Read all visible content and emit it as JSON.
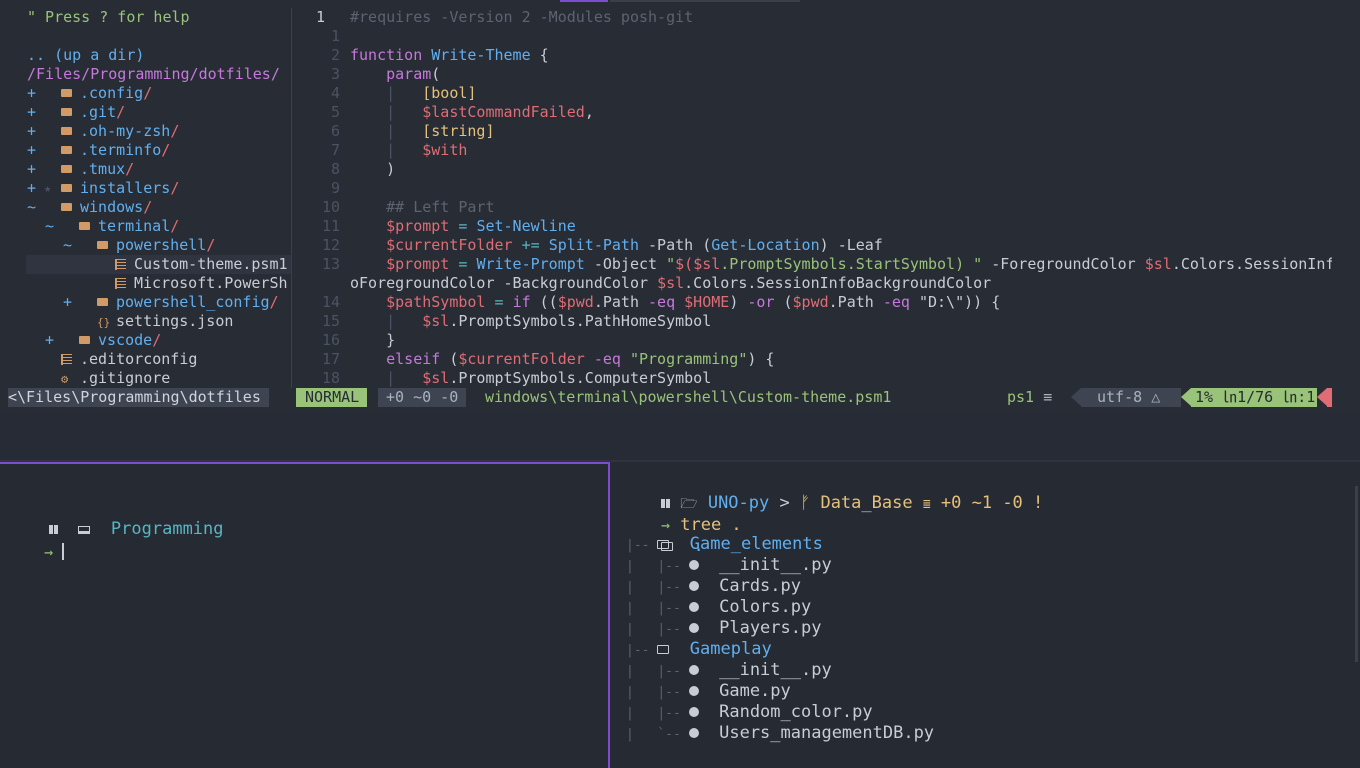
{
  "nerdtree": {
    "help": "\" Press ? for help",
    "up": ".. (up a dir)",
    "root": "/Files/Programming/dotfiles/",
    "items": [
      {
        "mark": "+",
        "name": ".config",
        "slash": "/",
        "type": "dir",
        "indent": 0
      },
      {
        "mark": "+",
        "name": ".git",
        "slash": "/",
        "type": "dir",
        "indent": 0
      },
      {
        "mark": "+",
        "name": ".oh-my-zsh",
        "slash": "/",
        "type": "dir",
        "indent": 0
      },
      {
        "mark": "+",
        "name": ".terminfo",
        "slash": "/",
        "type": "dir",
        "indent": 0
      },
      {
        "mark": "+",
        "name": ".tmux",
        "slash": "/",
        "type": "dir",
        "indent": 0
      },
      {
        "mark": "+",
        "name": "installers",
        "slash": "/",
        "type": "dir",
        "indent": 0
      },
      {
        "mark": "~",
        "name": "windows",
        "slash": "/",
        "type": "dir",
        "indent": 0
      },
      {
        "mark": "~",
        "name": "terminal",
        "slash": "/",
        "type": "dir",
        "indent": 1
      },
      {
        "mark": "~",
        "name": "powershell",
        "slash": "/",
        "type": "dir",
        "indent": 2
      },
      {
        "mark": "",
        "name": "Custom-theme.psm1",
        "slash": "",
        "type": "file",
        "indent": 3
      },
      {
        "mark": "",
        "name": "Microsoft.PowerSh",
        "slash": "",
        "type": "file",
        "indent": 3
      },
      {
        "mark": "+",
        "name": "powershell_config",
        "slash": "/",
        "type": "dir",
        "indent": 2
      },
      {
        "mark": "",
        "name": "settings.json",
        "slash": "",
        "type": "file",
        "indent": 2
      },
      {
        "mark": "+",
        "name": "vscode",
        "slash": "/",
        "type": "dir",
        "indent": 1
      },
      {
        "mark": "",
        "name": ".editorconfig",
        "slash": "",
        "type": "file",
        "indent": 0
      },
      {
        "mark": "",
        "name": ".gitignore",
        "slash": "",
        "type": "file",
        "indent": 0
      }
    ]
  },
  "editor": {
    "line_numbers": [
      "1",
      "1",
      "2",
      "3",
      "4",
      "5",
      "6",
      "7",
      "8",
      "9",
      "10",
      "11",
      "12",
      "13",
      "",
      "14",
      "15",
      "16",
      "17",
      "18"
    ],
    "lines": [
      "#requires -Version 2 -Modules posh-git",
      "",
      "function Write-Theme {",
      "    param(",
      "    |   [bool]",
      "    |   $lastCommandFailed,",
      "    |   [string]",
      "    |   $with",
      "    )",
      "",
      "    ## Left Part",
      "    $prompt = Set-Newline",
      "    $currentFolder += Split-Path -Path (Get-Location) -Leaf",
      "    $prompt = Write-Prompt -Object \"$($sl.PromptSymbols.StartSymbol) \" -ForegroundColor $sl.Colors.SessionInf",
      "oForegroundColor -BackgroundColor $sl.Colors.SessionInfoBackgroundColor",
      "    $pathSymbol = if (($pwd.Path -eq $HOME) -or ($pwd.Path -eq \"D:\\\")) {",
      "    |   $sl.PromptSymbols.PathHomeSymbol",
      "    }",
      "    elseif ($currentFolder -eq \"Programming\") {",
      "    |   $sl.PromptSymbols.ComputerSymbol"
    ]
  },
  "statusline": {
    "path": "<\\Files\\Programming\\dotfiles",
    "mode": "NORMAL",
    "git": "+0 ~0 -0",
    "file": "windows\\terminal\\powershell\\Custom-theme.psm1",
    "filetype": "ps1",
    "encoding": "utf-8",
    "position": "1% ㏑1/76 ㏑:1"
  },
  "left_pane": {
    "folder": "Programming",
    "prompt_arrow": "→"
  },
  "right_pane": {
    "repo": "UNO-py",
    "branch": "Data_Base",
    "git_status": "+0 ~1 -0 !",
    "command": "tree .",
    "prompt_arrow": "→",
    "tree_root": ".",
    "tree": [
      {
        "guide": "|-- ",
        "name": "Game_elements",
        "type": "dir",
        "depth": 0
      },
      {
        "guide": "|-- ",
        "name": "__init__.py",
        "type": "file",
        "depth": 1
      },
      {
        "guide": "|-- ",
        "name": "Cards.py",
        "type": "file",
        "depth": 1
      },
      {
        "guide": "|-- ",
        "name": "Colors.py",
        "type": "file",
        "depth": 1
      },
      {
        "guide": "|-- ",
        "name": "Players.py",
        "type": "file",
        "depth": 1
      },
      {
        "guide": "|-- ",
        "name": "Gameplay",
        "type": "dir",
        "depth": 0
      },
      {
        "guide": "|-- ",
        "name": "__init__.py",
        "type": "file",
        "depth": 1
      },
      {
        "guide": "|-- ",
        "name": "Game.py",
        "type": "file",
        "depth": 1
      },
      {
        "guide": "|-- ",
        "name": "Random_color.py",
        "type": "file",
        "depth": 1
      },
      {
        "guide": "`-- ",
        "name": "Users_managementDB.py",
        "type": "file",
        "depth": 1
      }
    ]
  },
  "colors": {
    "accent_purple": "#7c4dd1",
    "green": "#98c379",
    "blue": "#61afef",
    "red": "#e06c75",
    "yellow": "#e5c07b"
  }
}
